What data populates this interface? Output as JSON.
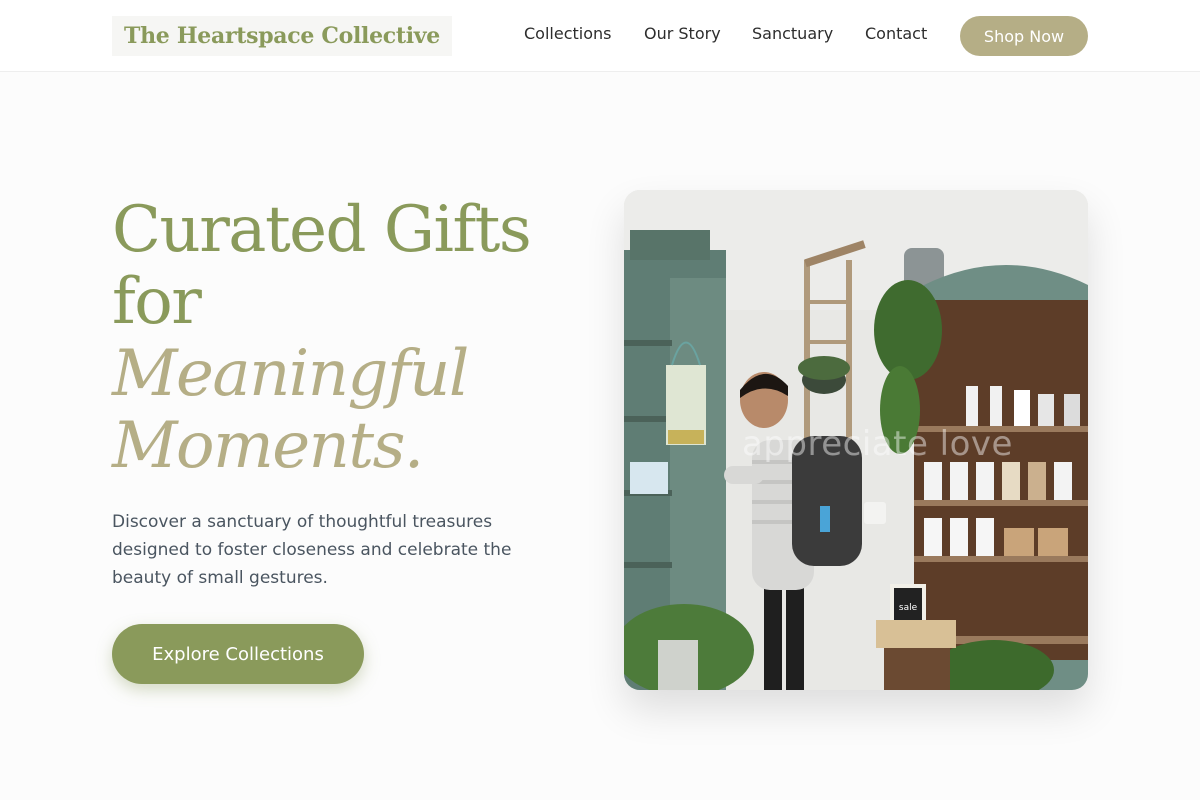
{
  "brand": {
    "name": "The Heartspace Collective",
    "primary_color": "#8a9a5b",
    "secondary_color": "#b5ae86"
  },
  "nav": {
    "links": [
      {
        "label": "Collections"
      },
      {
        "label": "Our Story"
      },
      {
        "label": "Sanctuary"
      },
      {
        "label": "Contact"
      }
    ],
    "cta_label": "Shop Now"
  },
  "hero": {
    "title_line_1": "Curated Gifts",
    "title_line_2": "for",
    "title_accent_1": "Meaningful",
    "title_accent_2": "Moments.",
    "description_lines": [
      "Discover a sanctuary of thoughtful treasures",
      "designed to foster closeness and celebrate the",
      "beauty of small gestures."
    ],
    "cta_label": "Explore Collections",
    "image": {
      "overlay_text": "appreciate love",
      "sign_text": "sale"
    }
  }
}
